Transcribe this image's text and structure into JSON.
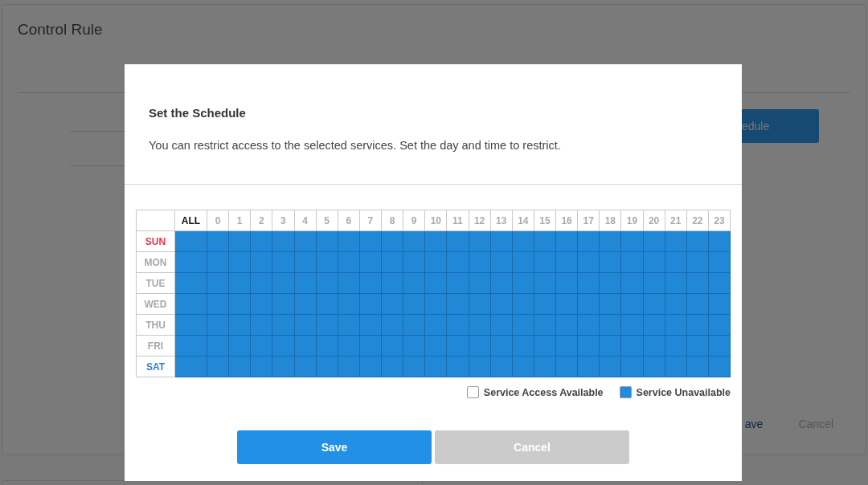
{
  "page": {
    "title": "Control Rule",
    "schedule_button": "edule",
    "save_link": "ave",
    "cancel_link": "Cancel"
  },
  "dialog": {
    "title": "Set the Schedule",
    "description": "You can restrict access to the selected services. Set the day and time to restrict.",
    "schedule": {
      "all_label": "ALL",
      "hours": [
        "0",
        "1",
        "2",
        "3",
        "4",
        "5",
        "6",
        "7",
        "8",
        "9",
        "10",
        "11",
        "12",
        "13",
        "14",
        "15",
        "16",
        "17",
        "18",
        "19",
        "20",
        "21",
        "22",
        "23"
      ],
      "days": [
        {
          "label": "SUN",
          "color": "#e8344a",
          "all": true,
          "blocked": [
            true,
            true,
            true,
            true,
            true,
            true,
            true,
            true,
            true,
            true,
            true,
            true,
            true,
            true,
            true,
            true,
            true,
            true,
            true,
            true,
            true,
            true,
            true,
            true
          ]
        },
        {
          "label": "MON",
          "color": "#a8a8a8",
          "all": true,
          "blocked": [
            true,
            true,
            true,
            true,
            true,
            true,
            true,
            true,
            true,
            true,
            true,
            true,
            true,
            true,
            true,
            true,
            true,
            true,
            true,
            true,
            true,
            true,
            true,
            true
          ]
        },
        {
          "label": "TUE",
          "color": "#a8a8a8",
          "all": true,
          "blocked": [
            true,
            true,
            true,
            true,
            true,
            true,
            true,
            true,
            true,
            true,
            true,
            true,
            true,
            true,
            true,
            true,
            true,
            true,
            true,
            true,
            true,
            true,
            true,
            true
          ]
        },
        {
          "label": "WED",
          "color": "#a8a8a8",
          "all": true,
          "blocked": [
            true,
            true,
            true,
            true,
            true,
            true,
            true,
            true,
            true,
            true,
            true,
            true,
            true,
            true,
            true,
            true,
            true,
            true,
            true,
            true,
            true,
            true,
            true,
            true
          ]
        },
        {
          "label": "THU",
          "color": "#a8a8a8",
          "all": true,
          "blocked": [
            true,
            true,
            true,
            true,
            true,
            true,
            true,
            true,
            true,
            true,
            true,
            true,
            true,
            true,
            true,
            true,
            true,
            true,
            true,
            true,
            true,
            true,
            true,
            true
          ]
        },
        {
          "label": "FRI",
          "color": "#a8a8a8",
          "all": true,
          "blocked": [
            true,
            true,
            true,
            true,
            true,
            true,
            true,
            true,
            true,
            true,
            true,
            true,
            true,
            true,
            true,
            true,
            true,
            true,
            true,
            true,
            true,
            true,
            true,
            true
          ]
        },
        {
          "label": "SAT",
          "color": "#2d7fe0",
          "all": true,
          "blocked": [
            true,
            true,
            true,
            true,
            true,
            true,
            true,
            true,
            true,
            true,
            true,
            true,
            true,
            true,
            true,
            true,
            true,
            true,
            true,
            true,
            true,
            true,
            true,
            true
          ]
        }
      ]
    },
    "legend": [
      {
        "label": "Service Access Available",
        "color": "#ffffff"
      },
      {
        "label": "Service Unavailable",
        "color": "#228be0"
      }
    ],
    "buttons": [
      {
        "label": "Save",
        "disabled": false
      },
      {
        "label": "Cancel",
        "disabled": true
      }
    ]
  }
}
